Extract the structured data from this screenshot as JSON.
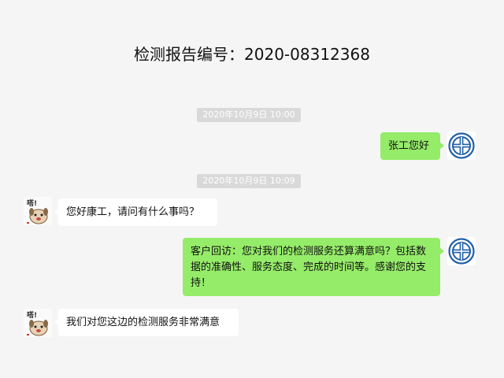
{
  "header": {
    "title": "检测报告编号：2020-08312368"
  },
  "messages": [
    {
      "type": "timestamp",
      "text": "2020年10月9日 10:00"
    },
    {
      "type": "sent",
      "text": "张工您好",
      "avatar": "shield-logo-icon"
    },
    {
      "type": "timestamp",
      "text": "2020年10月9日 10:09"
    },
    {
      "type": "received",
      "text": "您好康工，请问有什么事吗？",
      "avatar": "dog-sticker-icon"
    },
    {
      "type": "sent",
      "text": "客户回访：您对我们的检测服务还算满意吗？包括数据的准确性、服务态度、完成的时间等。感谢您的支持！",
      "avatar": "shield-logo-icon"
    },
    {
      "type": "received",
      "text": "我们对您这边的检测服务非常满意",
      "avatar": "dog-sticker-icon"
    }
  ],
  "colors": {
    "background": "#f5f5f5",
    "sent_bubble": "#95ec69",
    "received_bubble": "#ffffff",
    "timestamp_bg": "#d9d9d9",
    "logo_blue": "#1f5fa8"
  }
}
